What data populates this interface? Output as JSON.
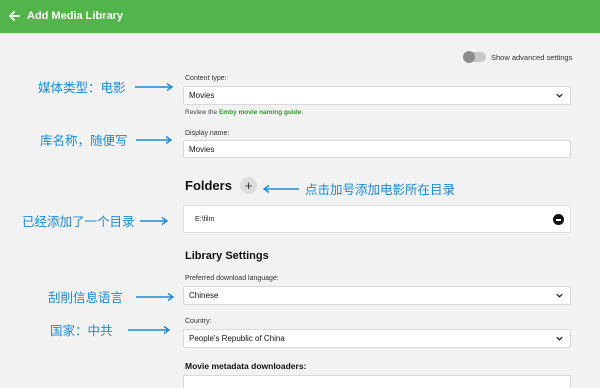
{
  "header": {
    "title": "Add Media Library",
    "color": "#52b54b"
  },
  "advanced": {
    "label": "Show advanced settings",
    "enabled": false
  },
  "content_type": {
    "label": "Content type:",
    "value": "Movies",
    "hint_prefix": "Review the ",
    "hint_link": "Emby movie naming guide",
    "hint_suffix": "."
  },
  "display_name": {
    "label": "Display name:",
    "value": "Movies"
  },
  "folders": {
    "title": "Folders",
    "add_symbol": "+",
    "items": [
      {
        "path": "E:\\film"
      }
    ]
  },
  "library_settings": {
    "title": "Library Settings",
    "download_language": {
      "label": "Preferred download language:",
      "value": "Chinese"
    },
    "country": {
      "label": "Country:",
      "value": "People's Republic of China"
    }
  },
  "metadata": {
    "title": "Movie metadata downloaders:"
  },
  "annotations": {
    "content_type": "媒体类型：电影",
    "display_name": "库名称，随便写",
    "add_folder": "点击加号添加电影所在目录",
    "folder_added": "已经添加了一个目录",
    "language": "刮削信息语言",
    "country": "国家：中共",
    "color": "#1a8ad9"
  }
}
